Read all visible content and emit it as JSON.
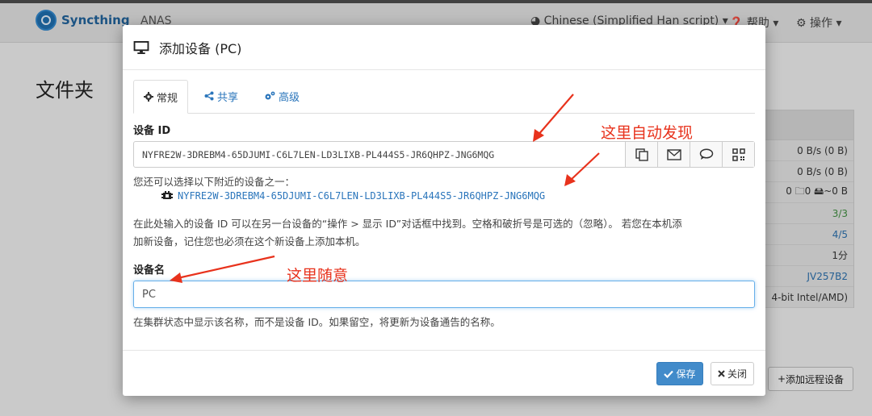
{
  "app": {
    "brand": "Syncthing",
    "device_name": "ANAS",
    "nav": {
      "language": "Chinese (Simplified Han script)",
      "help": "帮助",
      "actions": "操作"
    },
    "folders_title": "文件夹",
    "side_stats": [
      "0 B/s (0 B)",
      "0 B/s (0 B)",
      "0  🗀0  🖴~0 B",
      "3/3",
      "4/5",
      "1分",
      "JV257B2",
      "4-bit Intel/AMD)"
    ],
    "add_remote_device": "添加远程设备"
  },
  "modal": {
    "title": "添加设备 (PC)",
    "tabs": [
      {
        "label": "常规",
        "active": true
      },
      {
        "label": "共享",
        "active": false
      },
      {
        "label": "高级",
        "active": false
      }
    ],
    "device_id_label": "设备 ID",
    "device_id_value": "NYFRE2W-3DREBM4-65DJUMI-C6L7LEN-LD3LIXB-PL444S5-JR6QHPZ-JNG6MQG",
    "nearby_hint": "您还可以选择以下附近的设备之一：",
    "nearby_device": "NYFRE2W-3DREBM4-65DJUMI-C6L7LEN-LD3LIXB-PL444S5-JR6QHPZ-JNG6MQG",
    "id_help_line1": "在此处输入的设备 ID 可以在另一台设备的“操作 > 显示 ID”对话框中找到。空格和破折号是可选的（忽略）。 若您在本机添",
    "id_help_line2": "加新设备，记住您也必须在这个新设备上添加本机。",
    "device_name_label": "设备名",
    "device_name_value": "PC",
    "name_help": "在集群状态中显示该名称，而不是设备 ID。如果留空，将更新为设备通告的名称。",
    "save": "保存",
    "close": "关闭"
  },
  "annotations": {
    "auto_discover": "这里自动发现",
    "any_name": "这里随意"
  },
  "colors": {
    "accent": "#428bca",
    "link": "#2a75bb",
    "annotation": "#e8321c"
  },
  "icons": [
    "syncthing-logo-icon",
    "globe-icon",
    "question-icon",
    "gear-icon",
    "monitor-icon",
    "cog-icon",
    "share-icon",
    "cogs-icon",
    "copy-icon",
    "envelope-icon",
    "comment-icon",
    "qrcode-icon",
    "device-icon",
    "check-icon",
    "times-icon",
    "plus-icon"
  ]
}
